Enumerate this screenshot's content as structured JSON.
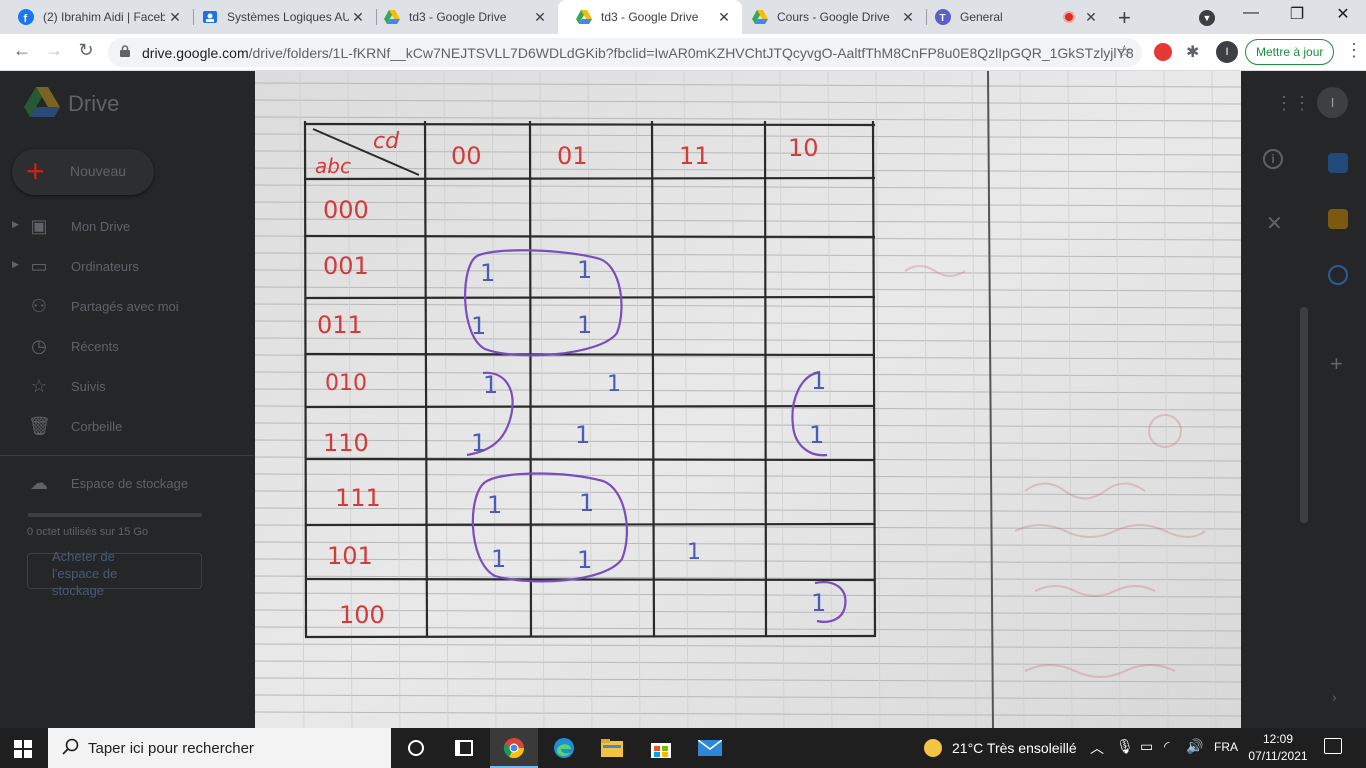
{
  "browser": {
    "tabs": [
      {
        "title": "(2) Ibrahim Aidi | Faceb",
        "favicon": "facebook-icon",
        "color": "#1877f2"
      },
      {
        "title": "Systèmes Logiques AU",
        "favicon": "classroom-icon",
        "color": "#1a73e8"
      },
      {
        "title": "td3 - Google Drive",
        "favicon": "drive-icon",
        "color": "#34a853"
      },
      {
        "title": "td3 - Google Drive",
        "favicon": "drive-icon",
        "color": "#34a853",
        "active": true
      },
      {
        "title": "Cours - Google Drive",
        "favicon": "drive-icon",
        "color": "#34a853"
      },
      {
        "title": "General",
        "favicon": "teams-icon",
        "color": "#5b5fc7"
      }
    ],
    "url_host": "drive.google.com",
    "url_path": "/drive/folders/1L-fKRNf__kCw7NEJTSVLL7D6WDLdGKib?fbclid=IwAR0mKZHVChtJTQcyvgO-AaltfThM8CnFP8u0E8QzlIpGQR_1GkSTzlyjlY8",
    "profile_initial": "I",
    "update_button": "Mettre à jour"
  },
  "drive": {
    "title": "Drive",
    "new_button": "Nouveau",
    "nav": [
      {
        "label": "Mon Drive",
        "icon": "my-drive-icon",
        "caret": true
      },
      {
        "label": "Ordinateurs",
        "icon": "computers-icon",
        "caret": true
      },
      {
        "label": "Partagés avec moi",
        "icon": "shared-icon"
      },
      {
        "label": "Récents",
        "icon": "clock-icon"
      },
      {
        "label": "Suivis",
        "icon": "star-icon"
      },
      {
        "label": "Corbeille",
        "icon": "trash-icon"
      }
    ],
    "storage_label": "Espace de stockage",
    "storage_used": "0 octet utilisés sur 15 Go",
    "buy_storage": "Acheter de l'espace de stockage",
    "avatar_initial": "I"
  },
  "kmap": {
    "corner_top": "cd",
    "corner_bottom": "abc",
    "columns": [
      "00",
      "01",
      "11",
      "10"
    ],
    "rows": [
      {
        "label": "000",
        "cells": [
          "",
          "",
          "",
          ""
        ]
      },
      {
        "label": "001",
        "cells": [
          "1",
          "1",
          "",
          ""
        ]
      },
      {
        "label": "011",
        "cells": [
          "1",
          "1",
          "",
          ""
        ]
      },
      {
        "label": "010",
        "cells": [
          "1",
          "1",
          "",
          "1"
        ]
      },
      {
        "label": "110",
        "cells": [
          "1",
          "1",
          "",
          "1"
        ]
      },
      {
        "label": "111",
        "cells": [
          "1",
          "1",
          "",
          ""
        ]
      },
      {
        "label": "101",
        "cells": [
          "1",
          "1",
          "1",
          ""
        ]
      },
      {
        "label": "100",
        "cells": [
          "",
          "",
          "",
          "1"
        ]
      }
    ],
    "ink_colors": {
      "labels": "#d43a3a",
      "ones": "#4a5cb8",
      "circles": "#7b4bc0",
      "lines": "#2a2a2a"
    }
  },
  "taskbar": {
    "search_placeholder": "Taper ici pour rechercher",
    "weather": "21°C  Très ensoleillé",
    "language": "FRA",
    "time": "12:09",
    "date": "07/11/2021"
  }
}
